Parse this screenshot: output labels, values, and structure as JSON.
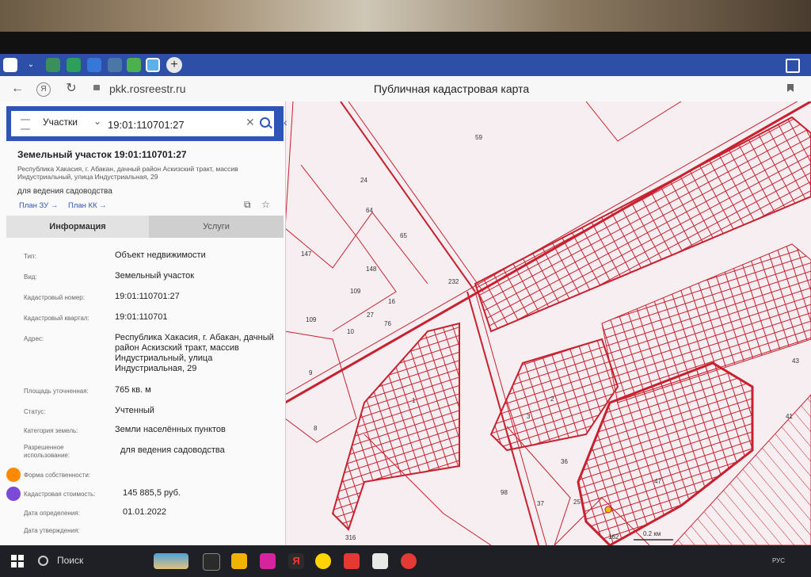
{
  "browser": {
    "url": "pkk.rosreestr.ru",
    "page_title": "Публичная кадастровая карта"
  },
  "search": {
    "category": "Участки",
    "query": "19:01:110701:27"
  },
  "parcel": {
    "title": "Земельный участок 19:01:110701:27",
    "address_line": "Республика Хакасия, г. Абакан, дачный район Аскизский тракт, массив Индустриальный, улица Индустриальная, 29",
    "purpose": "для ведения садоводства",
    "plan_zu": "План ЗУ",
    "plan_kk": "План КК"
  },
  "tabs": {
    "info": "Информация",
    "services": "Услуги"
  },
  "info": [
    {
      "label": "Тип:",
      "value": "Объект недвижимости"
    },
    {
      "label": "Вид:",
      "value": "Земельный участок"
    },
    {
      "label": "Кадастровый номер:",
      "value": "19:01:110701:27"
    },
    {
      "label": "Кадастровый квартал:",
      "value": "19:01:110701"
    },
    {
      "label": "Адрес:",
      "value": "Республика Хакасия, г. Абакан, дачный район Аскизский тракт, массив Индустриальный, улица Индустриальная, 29"
    },
    {
      "label": "Площадь уточненная:",
      "value": "765 кв. м"
    },
    {
      "label": "Статус:",
      "value": "Учтенный"
    },
    {
      "label": "Категория земель:",
      "value": "Земли населённых пунктов"
    },
    {
      "label": "Разрешенное использование:",
      "value": "для ведения садоводства"
    },
    {
      "label": "Форма собственности:",
      "value": ""
    },
    {
      "label": "Кадастровая стоимость:",
      "value": "145 885,5 руб."
    },
    {
      "label": "Дата определения:",
      "value": "01.01.2022"
    },
    {
      "label": "Дата утверждения:",
      "value": ""
    }
  ],
  "map_labels": [
    "59",
    "24",
    "64",
    "65",
    "147",
    "148",
    "109",
    "16",
    "27",
    "76",
    "10",
    "109",
    "9",
    "8",
    "232",
    "1",
    "2",
    "3",
    "36",
    "37",
    "98",
    "162",
    "316",
    "41",
    "47",
    "43",
    "25",
    "0.2 км"
  ],
  "taskbar": {
    "search_label": "Поиск",
    "lang": "РУС"
  },
  "colors": {
    "panel_blue": "#2e56b8",
    "map_bg": "#f6eef1",
    "parcel_line": "#c8202e"
  }
}
